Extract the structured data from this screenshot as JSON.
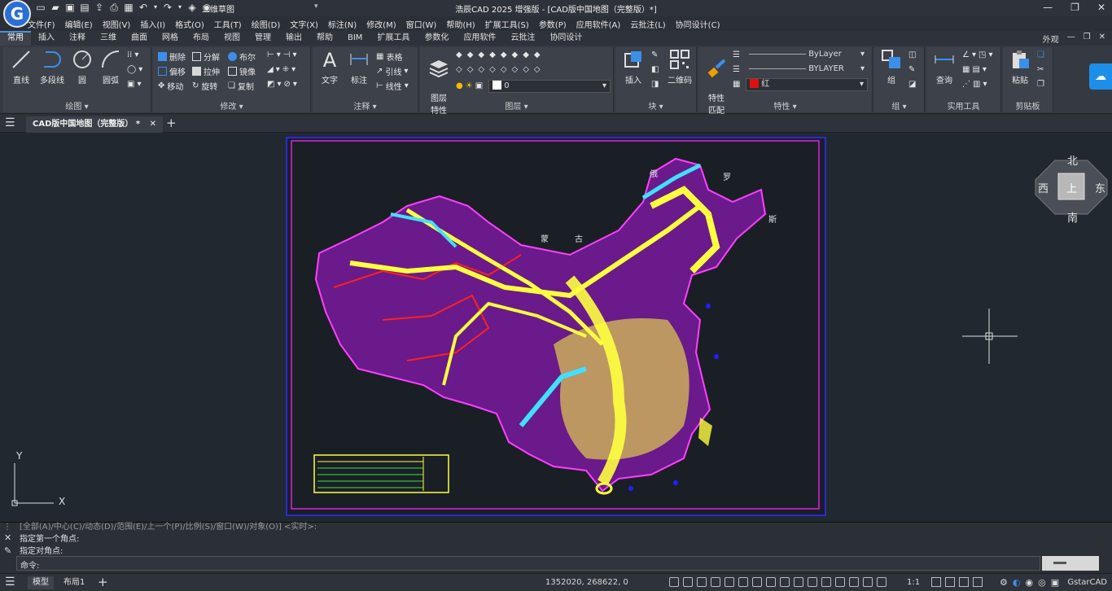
{
  "app": {
    "logo_letter": "G",
    "title": "浩辰CAD 2025 增强版 - [CAD版中国地图（完整版）*]",
    "workspace": "二维草图",
    "brand_color": "#2a6fd6"
  },
  "menu": [
    "文件(F)",
    "编辑(E)",
    "视图(V)",
    "插入(I)",
    "格式(O)",
    "工具(T)",
    "绘图(D)",
    "文字(X)",
    "标注(N)",
    "修改(M)",
    "窗口(W)",
    "帮助(H)",
    "扩展工具(S)",
    "参数(P)",
    "应用软件(A)",
    "云批注(L)",
    "协同设计(C)"
  ],
  "ribbon_tabs": [
    "常用",
    "插入",
    "注释",
    "三维",
    "曲面",
    "网格",
    "布局",
    "视图",
    "管理",
    "输出",
    "帮助",
    "BIM",
    "扩展工具",
    "参数化",
    "应用软件",
    "云批注",
    "协同设计"
  ],
  "ribbon_right": {
    "appearance": "外观"
  },
  "panels": {
    "draw": {
      "label": "绘图",
      "line": "直线",
      "pline": "多段线",
      "circle": "圆",
      "arc": "圆弧"
    },
    "modify": {
      "label": "修改",
      "erase": "删除",
      "explode": "分解",
      "boolean": "布尔",
      "offset": "偏移",
      "stretch": "拉伸",
      "mirror": "镜像",
      "move": "移动",
      "rotate": "旋转",
      "copy": "复制"
    },
    "annotation": {
      "label": "注释",
      "text": "文字",
      "dim": "标注",
      "table": "表格",
      "leader": "引线",
      "linear": "线性"
    },
    "layer": {
      "label": "图层",
      "props": "图层\n特性",
      "current": "0"
    },
    "block": {
      "label": "块",
      "insert": "插入",
      "qrcode": "二维码"
    },
    "properties": {
      "label": "特性",
      "match": "特性\n匹配",
      "layer1": "ByLayer",
      "layer2": "BYLAYER",
      "color": "红"
    },
    "group": {
      "label": "组",
      "group": "组"
    },
    "utility": {
      "label": "实用工具",
      "query": "查询"
    },
    "clipboard": {
      "label": "剪贴板",
      "paste": "粘贴"
    }
  },
  "doc_tab": "CAD版中国地图（完整版） *",
  "compass": {
    "north": "北",
    "south": "南",
    "east": "东",
    "west": "西",
    "top": "上"
  },
  "ucs": {
    "x": "X",
    "y": "Y"
  },
  "map_labels": {
    "russia": "俄",
    "russia2": "罗",
    "russia3": "斯",
    "mongolia_m": "蒙",
    "mongolia_g": "古"
  },
  "command_lines": {
    "partial": "[全部(A)/中心(C)/动态(D)/范围(E)/上一个(P)/比例(S)/窗口(W)/对象(O)] <实时>:",
    "line1": "指定第一个角点:",
    "line2": "指定对角点:",
    "prompt": "命令:"
  },
  "status": {
    "model": "模型",
    "layout": "布局1",
    "coords": "1352020, 268622, 0",
    "scale": "1:1",
    "brand": "GstarCAD"
  }
}
